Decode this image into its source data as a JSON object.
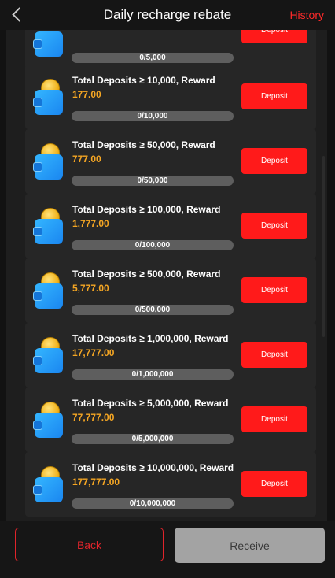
{
  "header": {
    "title": "Daily recharge rebate",
    "history_label": "History"
  },
  "tasks": [
    {
      "title": "",
      "reward": "",
      "progress_text": "0/5,000",
      "progress": 0,
      "button": "Deposit"
    },
    {
      "title": "Total Deposits ≥ 10,000, Reward",
      "reward": "177.00",
      "progress_text": "0/10,000",
      "progress": 0,
      "button": "Deposit"
    },
    {
      "title": "Total Deposits ≥ 50,000, Reward",
      "reward": "777.00",
      "progress_text": "0/50,000",
      "progress": 0,
      "button": "Deposit"
    },
    {
      "title": "Total Deposits ≥ 100,000, Reward",
      "reward": "1,777.00",
      "progress_text": "0/100,000",
      "progress": 0,
      "button": "Deposit"
    },
    {
      "title": "Total Deposits ≥ 500,000, Reward",
      "reward": "5,777.00",
      "progress_text": "0/500,000",
      "progress": 0,
      "button": "Deposit"
    },
    {
      "title": "Total Deposits ≥ 1,000,000, Reward",
      "reward": "17,777.00",
      "progress_text": "0/1,000,000",
      "progress": 0,
      "button": "Deposit"
    },
    {
      "title": "Total Deposits ≥ 5,000,000, Reward",
      "reward": "77,777.00",
      "progress_text": "0/5,000,000",
      "progress": 0,
      "button": "Deposit"
    },
    {
      "title": "Total Deposits ≥ 10,000,000, Reward",
      "reward": "177,777.00",
      "progress_text": "0/10,000,000",
      "progress": 0,
      "button": "Deposit"
    }
  ],
  "footer": {
    "back_label": "Back",
    "receive_label": "Receive"
  },
  "colors": {
    "accent": "#ff1a1a",
    "reward": "#f5a623",
    "card": "#262626"
  },
  "icons": {
    "back": "chevron-left-icon",
    "task": "wallet-coin-icon"
  }
}
